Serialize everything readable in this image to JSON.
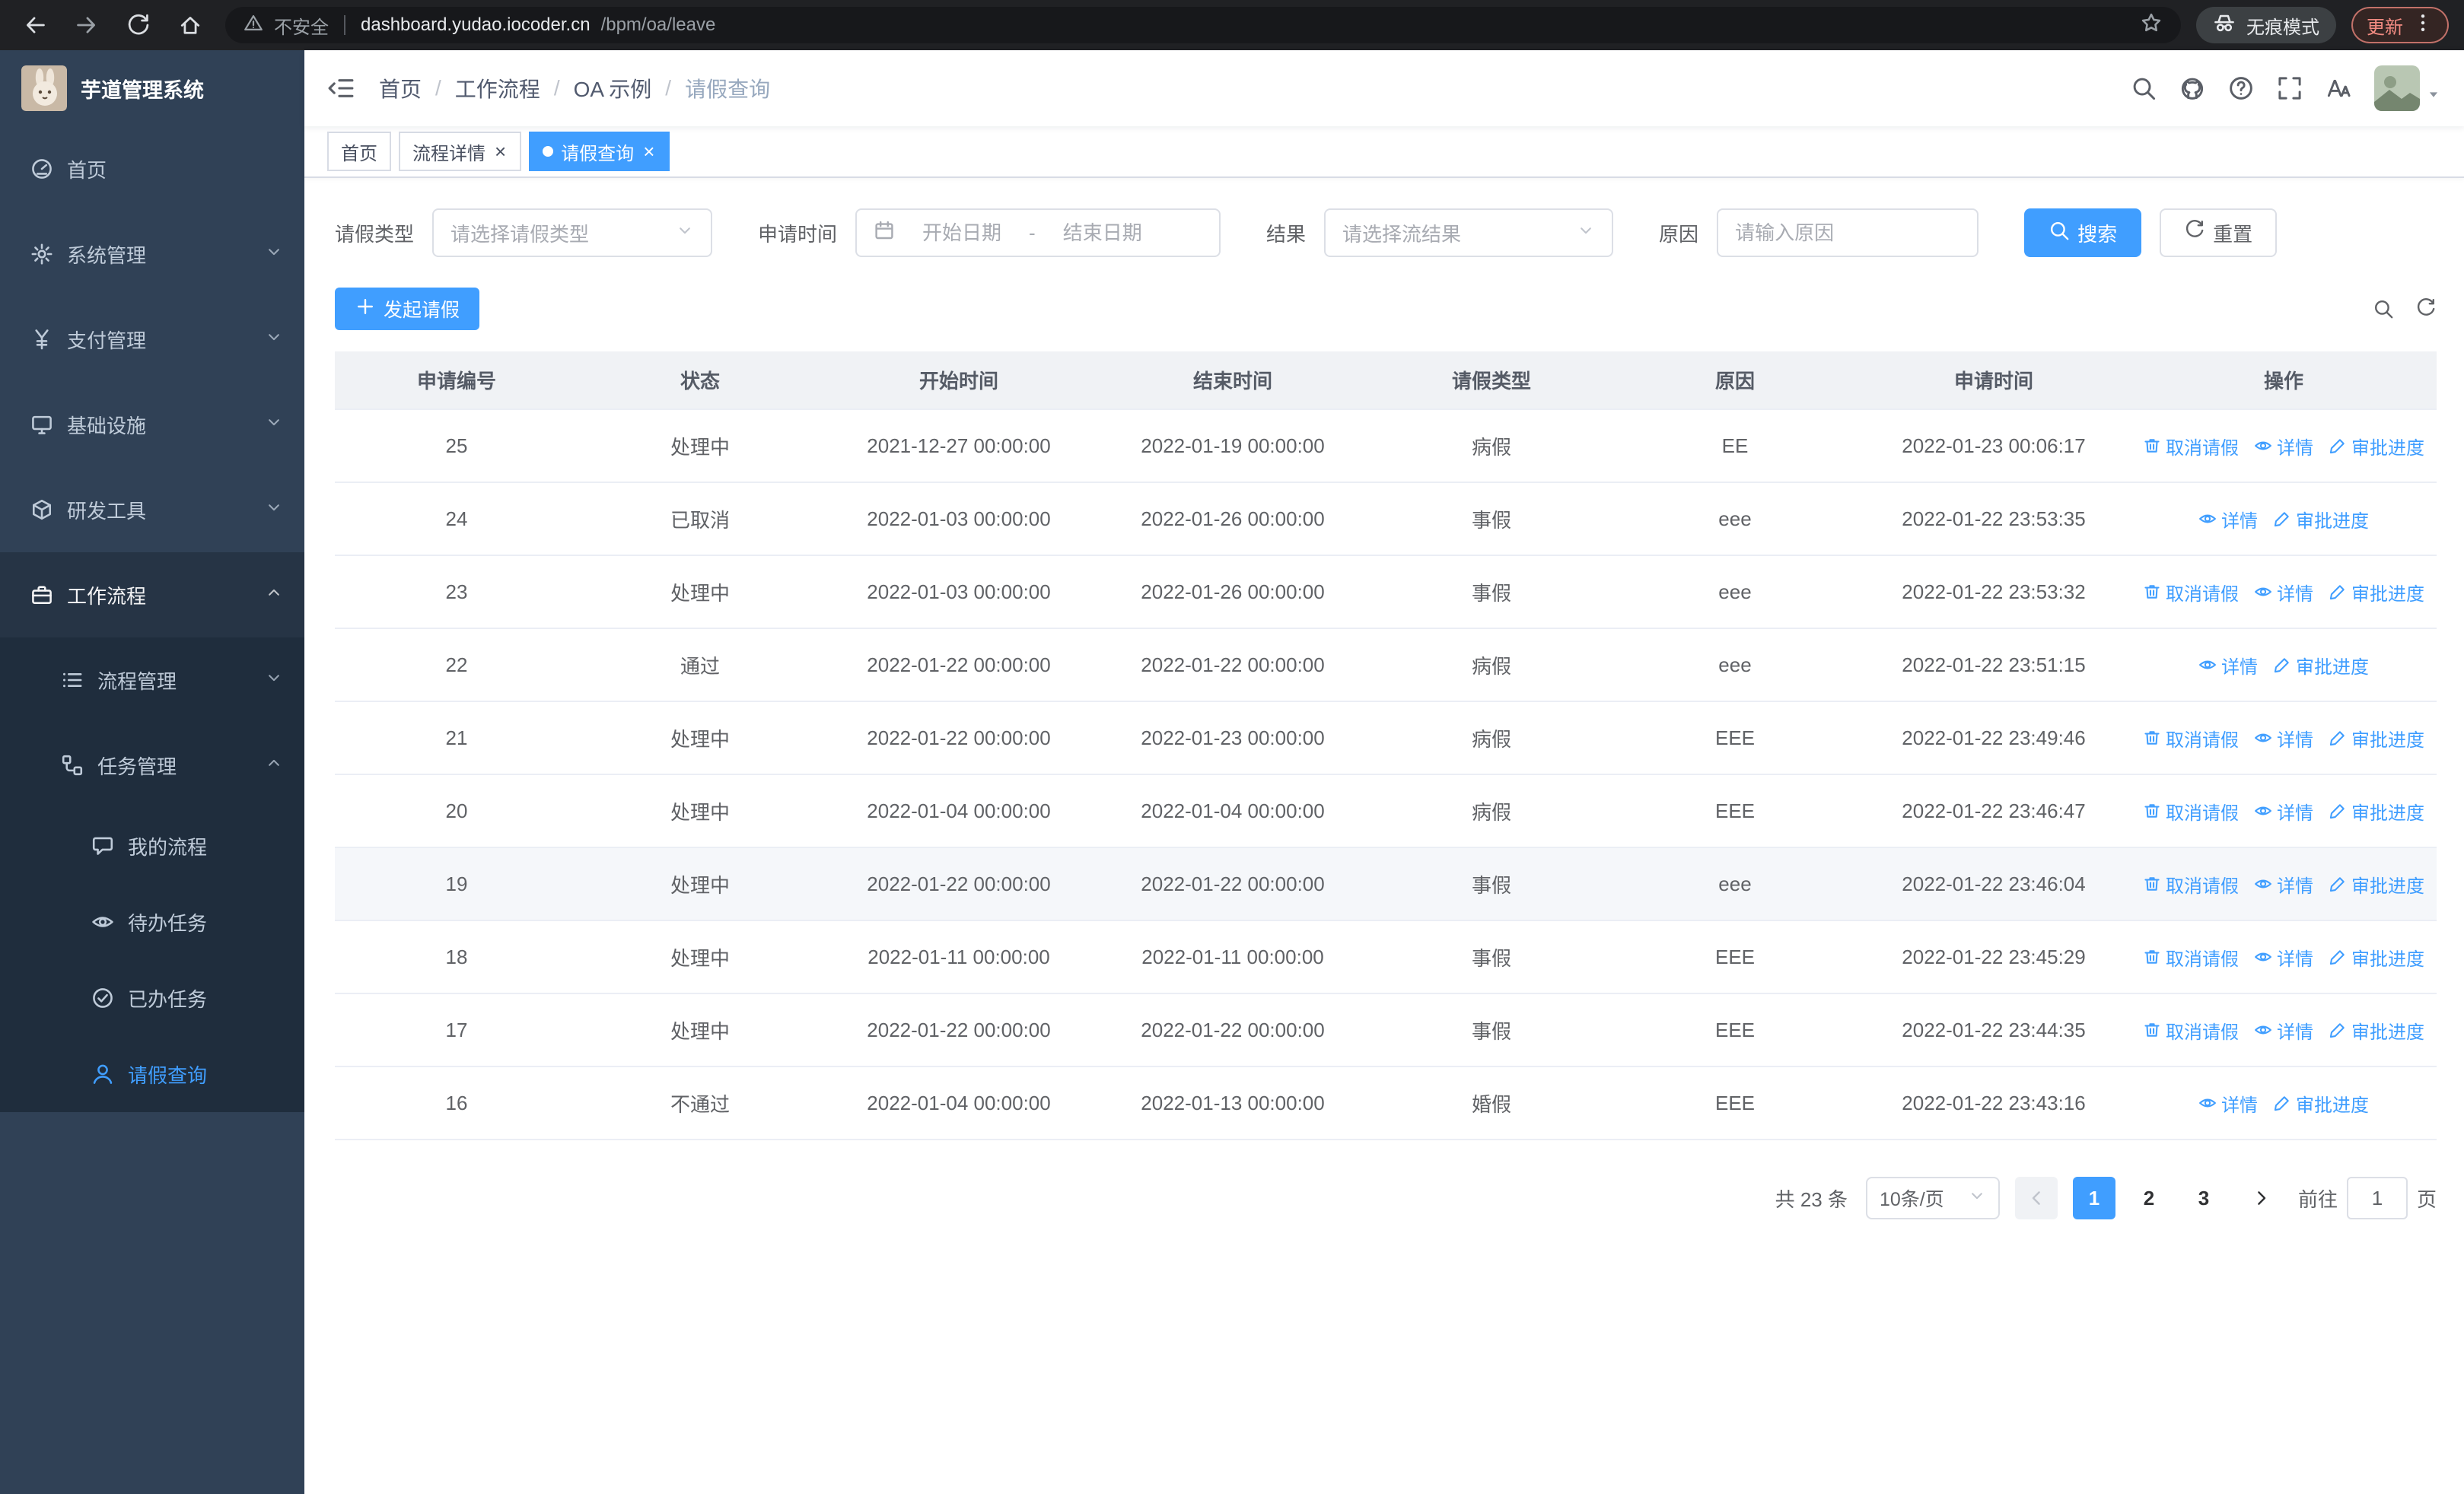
{
  "browser": {
    "nav": [
      "back-icon",
      "forward-icon",
      "reload-icon",
      "home-icon"
    ],
    "security_label": "不安全",
    "url_host": "dashboard.yudao.iocoder.cn",
    "url_path": "/bpm/oa/leave",
    "incognito_label": "无痕模式",
    "update_label": "更新"
  },
  "sidebar": {
    "title": "芋道管理系统",
    "menu": [
      {
        "key": "home",
        "label": "首页",
        "icon": "dashboard-icon",
        "level": 1,
        "chevron": ""
      },
      {
        "key": "system",
        "label": "系统管理",
        "icon": "settings-icon",
        "level": 1,
        "chevron": "down"
      },
      {
        "key": "payment",
        "label": "支付管理",
        "icon": "payment-icon",
        "level": 1,
        "chevron": "down"
      },
      {
        "key": "infrastructure",
        "label": "基础设施",
        "icon": "infrastructure-icon",
        "level": 1,
        "chevron": "down"
      },
      {
        "key": "devtools",
        "label": "研发工具",
        "icon": "devtools-icon",
        "level": 1,
        "chevron": "down"
      },
      {
        "key": "workflow",
        "label": "工作流程",
        "icon": "workflow-icon",
        "level": 1,
        "chevron": "up",
        "expanded": true
      },
      {
        "key": "process-mgmt",
        "label": "流程管理",
        "icon": "process-icon",
        "level": 2,
        "chevron": "down"
      },
      {
        "key": "task-mgmt",
        "label": "任务管理",
        "icon": "task-icon",
        "level": 2,
        "chevron": "up",
        "expanded": true
      },
      {
        "key": "my-process",
        "label": "我的流程",
        "icon": "my-process-icon",
        "level": 3
      },
      {
        "key": "todo-tasks",
        "label": "待办任务",
        "icon": "todo-icon",
        "level": 3
      },
      {
        "key": "done-tasks",
        "label": "已办任务",
        "icon": "done-icon",
        "level": 3
      },
      {
        "key": "leave-query",
        "label": "请假查询",
        "icon": "leave-icon",
        "level": 3,
        "active": true
      }
    ]
  },
  "breadcrumb": [
    "首页",
    "工作流程",
    "OA 示例",
    "请假查询"
  ],
  "header_icons": [
    "search-icon",
    "github-icon",
    "help-icon",
    "fullscreen-icon",
    "font-size-icon"
  ],
  "tags": [
    {
      "key": "home",
      "label": "首页",
      "active": false,
      "closable": false
    },
    {
      "key": "process-detail",
      "label": "流程详情",
      "active": false,
      "closable": true
    },
    {
      "key": "leave-query",
      "label": "请假查询",
      "active": true,
      "closable": true
    }
  ],
  "filters": {
    "leave_type_label": "请假类型",
    "leave_type_placeholder": "请选择请假类型",
    "apply_time_label": "申请时间",
    "start_date_placeholder": "开始日期",
    "range_separator": "-",
    "end_date_placeholder": "结束日期",
    "result_label": "结果",
    "result_placeholder": "请选择流结果",
    "reason_label": "原因",
    "reason_placeholder": "请输入原因",
    "search_label": "搜索",
    "reset_label": "重置"
  },
  "toolbar": {
    "create_label": "发起请假"
  },
  "table": {
    "columns": [
      "申请编号",
      "状态",
      "开始时间",
      "结束时间",
      "请假类型",
      "原因",
      "申请时间",
      "操作"
    ],
    "action_labels": {
      "cancel": "取消请假",
      "detail": "详情",
      "progress": "审批进度"
    },
    "rows": [
      {
        "id": "25",
        "status": "处理中",
        "start": "2021-12-27 00:00:00",
        "end": "2022-01-19 00:00:00",
        "type": "病假",
        "reason": "EE",
        "apply_time": "2022-01-23 00:06:17",
        "cancelable": true,
        "highlight": false
      },
      {
        "id": "24",
        "status": "已取消",
        "start": "2022-01-03 00:00:00",
        "end": "2022-01-26 00:00:00",
        "type": "事假",
        "reason": "eee",
        "apply_time": "2022-01-22 23:53:35",
        "cancelable": false,
        "highlight": false
      },
      {
        "id": "23",
        "status": "处理中",
        "start": "2022-01-03 00:00:00",
        "end": "2022-01-26 00:00:00",
        "type": "事假",
        "reason": "eee",
        "apply_time": "2022-01-22 23:53:32",
        "cancelable": true,
        "highlight": false
      },
      {
        "id": "22",
        "status": "通过",
        "start": "2022-01-22 00:00:00",
        "end": "2022-01-22 00:00:00",
        "type": "病假",
        "reason": "eee",
        "apply_time": "2022-01-22 23:51:15",
        "cancelable": false,
        "highlight": false
      },
      {
        "id": "21",
        "status": "处理中",
        "start": "2022-01-22 00:00:00",
        "end": "2022-01-23 00:00:00",
        "type": "病假",
        "reason": "EEE",
        "apply_time": "2022-01-22 23:49:46",
        "cancelable": true,
        "highlight": false
      },
      {
        "id": "20",
        "status": "处理中",
        "start": "2022-01-04 00:00:00",
        "end": "2022-01-04 00:00:00",
        "type": "病假",
        "reason": "EEE",
        "apply_time": "2022-01-22 23:46:47",
        "cancelable": true,
        "highlight": false
      },
      {
        "id": "19",
        "status": "处理中",
        "start": "2022-01-22 00:00:00",
        "end": "2022-01-22 00:00:00",
        "type": "事假",
        "reason": "eee",
        "apply_time": "2022-01-22 23:46:04",
        "cancelable": true,
        "highlight": true
      },
      {
        "id": "18",
        "status": "处理中",
        "start": "2022-01-11 00:00:00",
        "end": "2022-01-11 00:00:00",
        "type": "事假",
        "reason": "EEE",
        "apply_time": "2022-01-22 23:45:29",
        "cancelable": true,
        "highlight": false
      },
      {
        "id": "17",
        "status": "处理中",
        "start": "2022-01-22 00:00:00",
        "end": "2022-01-22 00:00:00",
        "type": "事假",
        "reason": "EEE",
        "apply_time": "2022-01-22 23:44:35",
        "cancelable": true,
        "highlight": false
      },
      {
        "id": "16",
        "status": "不通过",
        "start": "2022-01-04 00:00:00",
        "end": "2022-01-13 00:00:00",
        "type": "婚假",
        "reason": "EEE",
        "apply_time": "2022-01-22 23:43:16",
        "cancelable": false,
        "highlight": false
      }
    ]
  },
  "pagination": {
    "total_label": "共 23 条",
    "page_size_label": "10条/页",
    "pages": [
      "1",
      "2",
      "3"
    ],
    "active_page": "1",
    "goto_label": "前往",
    "goto_value": "1",
    "page_suffix": "页"
  },
  "colors": {
    "accent": "#409eff",
    "sidebar_bg": "#304156",
    "submenu_bg": "#1f2d3d"
  }
}
